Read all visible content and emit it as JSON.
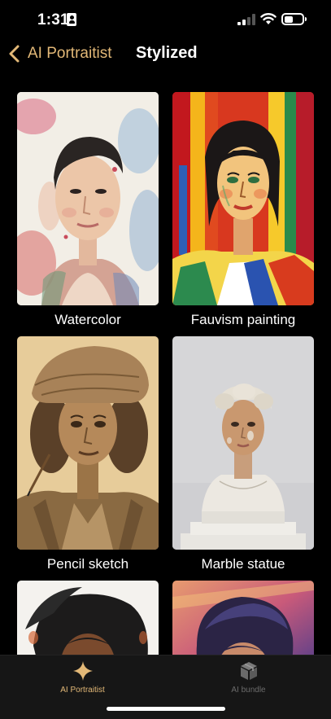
{
  "status_bar": {
    "time": "1:31"
  },
  "nav": {
    "back_label": "AI Portraitist",
    "title": "Stylized"
  },
  "styles": [
    {
      "label": "Watercolor"
    },
    {
      "label": "Fauvism painting"
    },
    {
      "label": "Pencil sketch"
    },
    {
      "label": "Marble statue"
    },
    {
      "label": ""
    },
    {
      "label": ""
    }
  ],
  "tabs": [
    {
      "label": "AI Portraitist",
      "icon": "sparkle-icon",
      "active": true
    },
    {
      "label": "AI bundle",
      "icon": "box-icon",
      "active": false
    }
  ],
  "colors": {
    "accent": "#e2b877",
    "background": "#000000",
    "tab_bar": "#161616",
    "inactive": "#6b6b6b"
  }
}
